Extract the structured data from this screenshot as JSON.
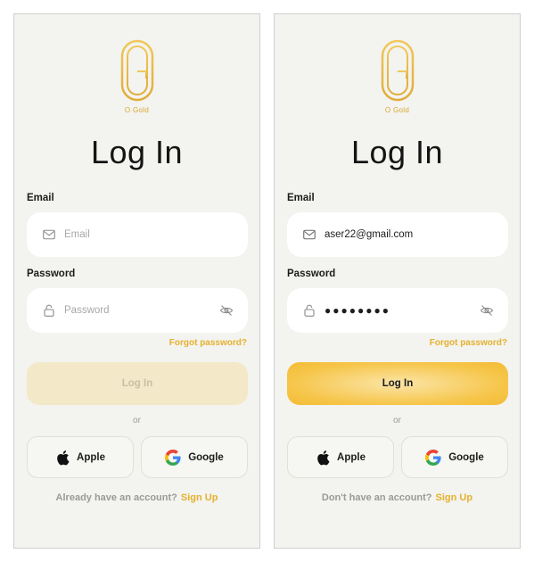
{
  "colors": {
    "accent": "#e5b12f",
    "button_active": "#f6c548",
    "button_disabled": "#f3e8c7",
    "background": "#f3f3ef"
  },
  "screens": [
    {
      "brand": "O Gold",
      "title": "Log In",
      "email_label": "Email",
      "email_value": "Email",
      "email_is_placeholder": true,
      "password_label": "Password",
      "password_value": "Password",
      "password_is_placeholder": true,
      "forgot": "Forgot password?",
      "login_button": "Log In",
      "login_enabled": false,
      "or": "or",
      "apple": "Apple",
      "google": "Google",
      "footer_text": "Already have an account?",
      "footer_link": "Sign Up"
    },
    {
      "brand": "O Gold",
      "title": "Log In",
      "email_label": "Email",
      "email_value": "aser22@gmail.com",
      "email_is_placeholder": false,
      "password_label": "Password",
      "password_value": "●●●●●●●●",
      "password_is_placeholder": false,
      "forgot": "Forgot password?",
      "login_button": "Log In",
      "login_enabled": true,
      "or": "or",
      "apple": "Apple",
      "google": "Google",
      "footer_text": "Don't have an account?",
      "footer_link": "Sign Up"
    }
  ]
}
